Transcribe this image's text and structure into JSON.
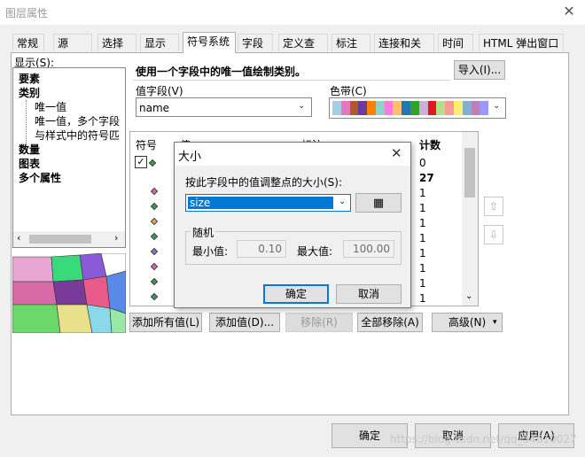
{
  "window": {
    "title": "图层属性",
    "close": "✕"
  },
  "tabs": [
    "常规",
    "源",
    "选择",
    "显示",
    "符号系统",
    "字段",
    "定义查询",
    "标注",
    "连接和关联",
    "时间",
    "HTML 弹出窗口"
  ],
  "show": {
    "label": "显示(S):",
    "tree": [
      {
        "text": "要素",
        "bold": true
      },
      {
        "text": "类别",
        "bold": true
      },
      {
        "text": "唯一值",
        "bold": false
      },
      {
        "text": "唯一值，多个字段",
        "bold": false
      },
      {
        "text": "与样式中的符号匹",
        "bold": false
      },
      {
        "text": "数量",
        "bold": true
      },
      {
        "text": "图表",
        "bold": true
      },
      {
        "text": "多个属性",
        "bold": true
      }
    ]
  },
  "symbology": {
    "description": "使用一个字段中的唯一值绘制类别。",
    "import_button": "导入(I)...",
    "value_field_label": "值字段(V)",
    "value_field_value": "name",
    "color_ramp_label": "色带(C)",
    "color_ramp_colors": [
      "#a6cee3",
      "#e377c2",
      "#b15928",
      "#6a3d9a",
      "#ff7f00",
      "#8dd3c7",
      "#ff79e0",
      "#fdbf6f",
      "#1f78b4",
      "#33a02c",
      "#cab2d6",
      "#e31a1c",
      "#b2df8a",
      "#fb9a99",
      "#ffed6f",
      "#80b1d3",
      "#bc80bd",
      "#9999ff"
    ],
    "columns": [
      "符号",
      "值",
      "标注",
      "计数"
    ],
    "counts": [
      "0",
      "27",
      "1",
      "1",
      "1",
      "1",
      "1",
      "1",
      "1",
      "1",
      "1"
    ],
    "symbol_colors": [
      "#3a9a5a",
      "#d966a6",
      "#3a9a5a",
      "#e8a060",
      "#3a9a5a",
      "#8877cc",
      "#d966a6",
      "#3a9a5a",
      "#3a9a5a"
    ],
    "buttons": {
      "add_all": "添加所有值(L)",
      "add_value": "添加值(D)...",
      "remove": "移除(R)",
      "remove_all": "全部移除(A)",
      "advanced": "高级(N)"
    }
  },
  "dialog": {
    "title": "大小",
    "field_label": "按此字段中的值调整点的大小(S):",
    "field_value": "size",
    "random_label": "随机",
    "min_label": "最小值:",
    "min_value": "0.10",
    "max_label": "最大值:",
    "max_value": "100.00",
    "ok": "确定",
    "cancel": "取消"
  },
  "footer": {
    "ok": "确定",
    "cancel": "取消",
    "apply": "应用(A)",
    "watermark": "https://blog.csdn.net/qq_34610027"
  }
}
